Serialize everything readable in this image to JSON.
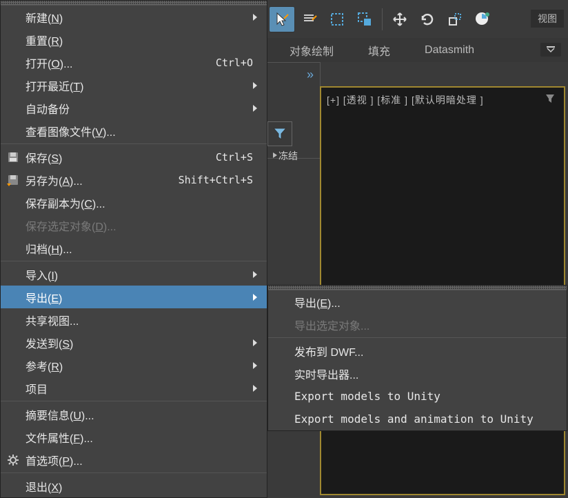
{
  "toolbar": {
    "view_label": "视图"
  },
  "secondary": {
    "object_draw": "对象绘制",
    "fill": "填充",
    "datasmith": "Datasmith"
  },
  "side": {
    "freeze": "冻结"
  },
  "viewport": {
    "header": "[+] [透视 ] [标准 ] [默认明暗处理 ]"
  },
  "file_menu": [
    {
      "label_pre": "新建(",
      "u": "N",
      "label_post": ")",
      "arrow": true
    },
    {
      "label_pre": "重置(",
      "u": "R",
      "label_post": ")"
    },
    {
      "label_pre": "打开(",
      "u": "O",
      "label_post": ")...",
      "shortcut": "Ctrl+O"
    },
    {
      "label_pre": "打开最近(",
      "u": "T",
      "label_post": ")",
      "arrow": true
    },
    {
      "label_pre": "自动备份",
      "arrow": true
    },
    {
      "label_pre": "查看图像文件(",
      "u": "V",
      "label_post": ")..."
    },
    {
      "sep": true
    },
    {
      "label_pre": "保存(",
      "u": "S",
      "label_post": ")",
      "shortcut": "Ctrl+S",
      "icon": "save"
    },
    {
      "label_pre": "另存为(",
      "u": "A",
      "label_post": ")...",
      "shortcut": "Shift+Ctrl+S",
      "icon": "saveas"
    },
    {
      "label_pre": "保存副本为(",
      "u": "C",
      "label_post": ")..."
    },
    {
      "label_pre": "保存选定对象(",
      "u": "D",
      "label_post": ")...",
      "disabled": true
    },
    {
      "label_pre": "归档(",
      "u": "H",
      "label_post": ")..."
    },
    {
      "sep": true
    },
    {
      "label_pre": "导入(",
      "u": "I",
      "label_post": ")",
      "arrow": true
    },
    {
      "label_pre": "导出(",
      "u": "E",
      "label_post": ")",
      "arrow": true,
      "highlighted": true
    },
    {
      "label_pre": "共享视图..."
    },
    {
      "label_pre": "发送到(",
      "u": "S",
      "label_post": ")",
      "arrow": true
    },
    {
      "label_pre": "参考(",
      "u": "R",
      "label_post": ")",
      "arrow": true
    },
    {
      "label_pre": "项目",
      "arrow": true
    },
    {
      "sep": true
    },
    {
      "label_pre": "摘要信息(",
      "u": "U",
      "label_post": ")..."
    },
    {
      "label_pre": "文件属性(",
      "u": "F",
      "label_post": ")..."
    },
    {
      "label_pre": "首选项(",
      "u": "P",
      "label_post": ")...",
      "icon": "gear"
    },
    {
      "sep": true
    },
    {
      "label_pre": "退出(",
      "u": "X",
      "label_post": ")"
    }
  ],
  "export_menu": [
    {
      "label_pre": "导出(",
      "u": "E",
      "label_post": ")..."
    },
    {
      "label_pre": "导出选定对象...",
      "disabled": true
    },
    {
      "sep": true
    },
    {
      "label_pre": "发布到 DWF...",
      "mono_part": true
    },
    {
      "label_pre": "实时导出器..."
    },
    {
      "label_pre": "Export models to Unity",
      "mono": true
    },
    {
      "label_pre": "Export models and animation to Unity",
      "mono": true
    }
  ]
}
